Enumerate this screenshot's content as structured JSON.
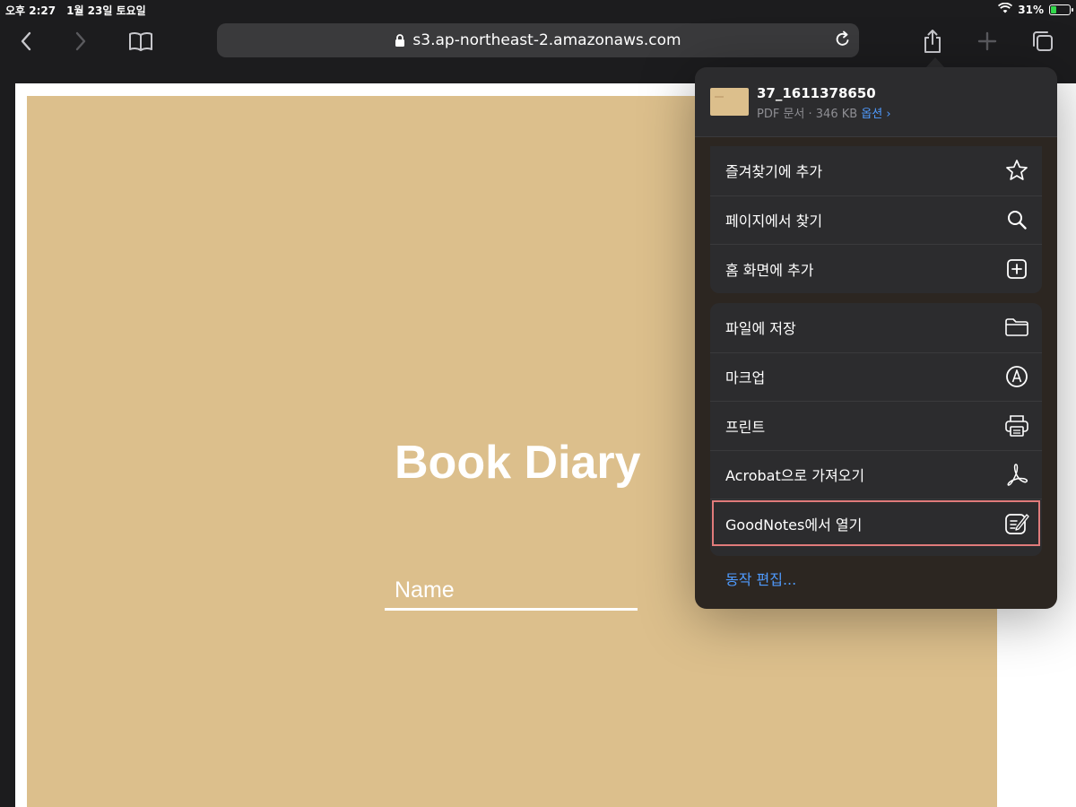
{
  "status_bar": {
    "time": "오후 2:27",
    "date": "1월 23일 토요일",
    "battery": "31%",
    "battery_level": 0.31
  },
  "toolbar": {
    "url": "s3.ap-northeast-2.amazonaws.com"
  },
  "page": {
    "title": "Book Diary",
    "name_label": "Name"
  },
  "share_sheet": {
    "file_name": "37_1611378650",
    "file_meta": "PDF 문서 · 346 KB",
    "options_label": "옵션 ›",
    "group1": [
      {
        "label": "즐겨찾기에 추가",
        "icon": "star-icon"
      },
      {
        "label": "페이지에서 찾기",
        "icon": "search-icon"
      },
      {
        "label": "홈 화면에 추가",
        "icon": "add-square-icon"
      }
    ],
    "group2": [
      {
        "label": "파일에 저장",
        "icon": "folder-icon"
      },
      {
        "label": "마크업",
        "icon": "markup-icon"
      },
      {
        "label": "프린트",
        "icon": "printer-icon"
      },
      {
        "label": "Acrobat으로 가져오기",
        "icon": "acrobat-icon"
      },
      {
        "label": "GoodNotes에서 열기",
        "icon": "goodnotes-icon"
      }
    ],
    "edit_actions": "동작 편집..."
  },
  "colors": {
    "accent": "#4f9bff",
    "page_tan": "#dcbf8c",
    "highlight": "#e07b7b"
  }
}
